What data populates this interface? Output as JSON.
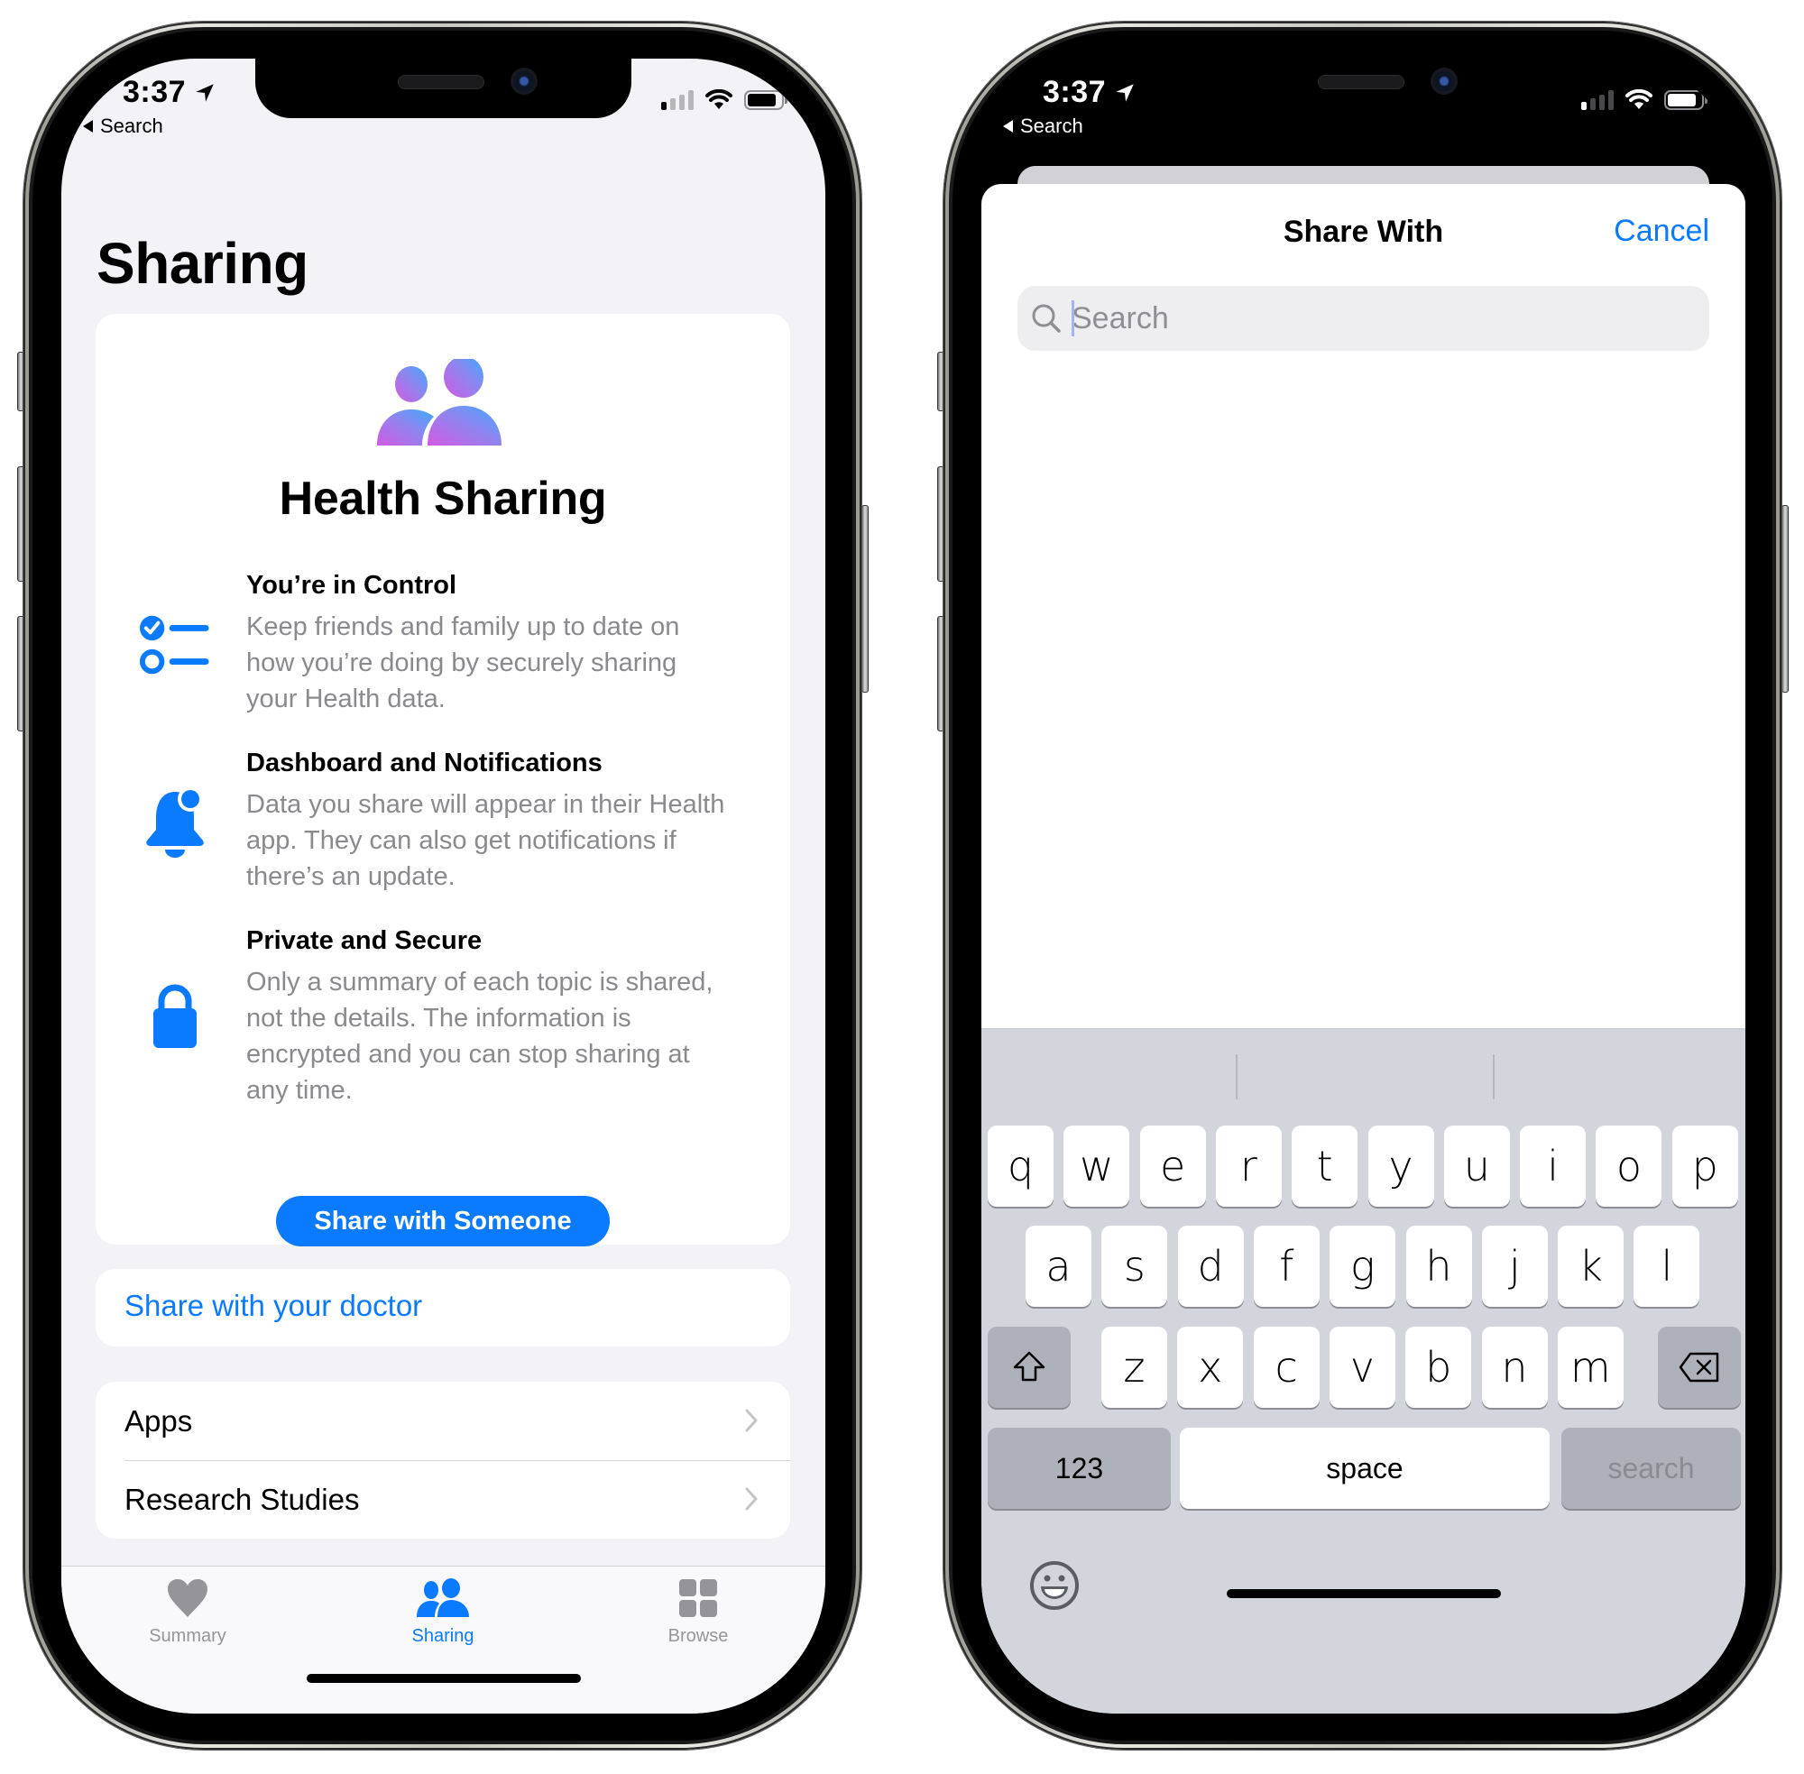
{
  "left_phone": {
    "status_bar": {
      "time": "3:37",
      "location_icon": "location-arrow-icon",
      "back_label": "Search",
      "signal_bars_active": 1,
      "signal_bars_total": 4,
      "battery_level": 0.85
    },
    "page_title": "Sharing",
    "hero": {
      "icon": "people-gradient-icon",
      "title": "Health Sharing",
      "features": [
        {
          "icon": "checklist-icon",
          "title": "You’re in Control",
          "lines": [
            "Keep friends and family up to date on",
            "how you’re doing by securely sharing",
            "your Health data."
          ]
        },
        {
          "icon": "bell-badge-icon",
          "title": "Dashboard and Notifications",
          "lines": [
            "Data you share will appear in their Health",
            "app. They can also get notifications if",
            "there’s an update."
          ]
        },
        {
          "icon": "lock-icon",
          "title": "Private and Secure",
          "lines": [
            "Only a summary of each topic is shared,",
            "not the details. The information is",
            "encrypted and you can stop sharing at",
            "any time."
          ]
        }
      ],
      "button_label": "Share with Someone"
    },
    "doctor_link": "Share with your doctor",
    "list_items": [
      {
        "label": "Apps"
      },
      {
        "label": "Research Studies"
      }
    ],
    "tabs": [
      {
        "label": "Summary",
        "icon": "heart-icon",
        "active": false
      },
      {
        "label": "Sharing",
        "icon": "people-icon",
        "active": true
      },
      {
        "label": "Browse",
        "icon": "grid-icon",
        "active": false
      }
    ]
  },
  "right_phone": {
    "status_bar": {
      "time": "3:37",
      "location_icon": "location-arrow-icon",
      "back_label": "Search",
      "signal_bars_active": 1,
      "signal_bars_total": 4,
      "battery_level": 0.85
    },
    "sheet": {
      "title": "Share With",
      "cancel_label": "Cancel",
      "search_placeholder": "Search",
      "search_value": ""
    },
    "keyboard": {
      "row1": [
        "q",
        "w",
        "e",
        "r",
        "t",
        "y",
        "u",
        "i",
        "o",
        "p"
      ],
      "row2": [
        "a",
        "s",
        "d",
        "f",
        "g",
        "h",
        "j",
        "k",
        "l"
      ],
      "row3": [
        "z",
        "x",
        "c",
        "v",
        "b",
        "n",
        "m"
      ],
      "numbers_label": "123",
      "space_label": "space",
      "return_label": "search",
      "shift_icon": "shift-icon",
      "delete_icon": "delete-icon",
      "emoji_icon": "emoji-icon"
    }
  },
  "colors": {
    "accent": "#0A7AFF",
    "grouped_background": "#F2F2F7",
    "secondary_text": "#8A8A8E",
    "tab_inactive": "#959599",
    "keyboard_background": "#D2D5DB",
    "keyboard_dark_key": "#ADB1B9"
  }
}
